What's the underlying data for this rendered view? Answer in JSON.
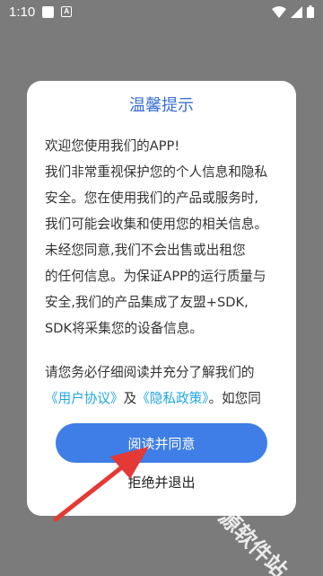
{
  "status_bar": {
    "time": "1:10",
    "notification_icons": [
      "square-icon",
      "a-icon"
    ],
    "right_icons": [
      "wifi-icon",
      "signal-icon",
      "battery-icon"
    ]
  },
  "dialog": {
    "title": "温馨提示",
    "lines": [
      "欢迎您使用我们的APP!",
      "我们非常重视保护您的个人信息和隐私",
      "安全。您在使用我们的产品或服务时,",
      "我们可能会收集和使用您的相关信息。",
      "未经您同意,我们不会出售或出租您",
      "的任何信息。为保证APP的运行质量与",
      "安全,我们的产品集成了友盟+SDK,",
      "SDK将采集您的设备信息。"
    ],
    "notice_line": "请您务必仔细阅读并充分了解我们的",
    "user_agreement_link": "《用户协议》",
    "and_text": "及",
    "privacy_policy_link": "《隐私政策》",
    "trailing_text": "。如您同",
    "agree_label": "阅读并同意",
    "reject_label": "拒绝并退出"
  },
  "watermark": "千源软件站",
  "colors": {
    "title": "#3a6fd0",
    "link": "#1fa6dc",
    "agree_button": "#3e7ee6",
    "arrow": "#e53935"
  }
}
